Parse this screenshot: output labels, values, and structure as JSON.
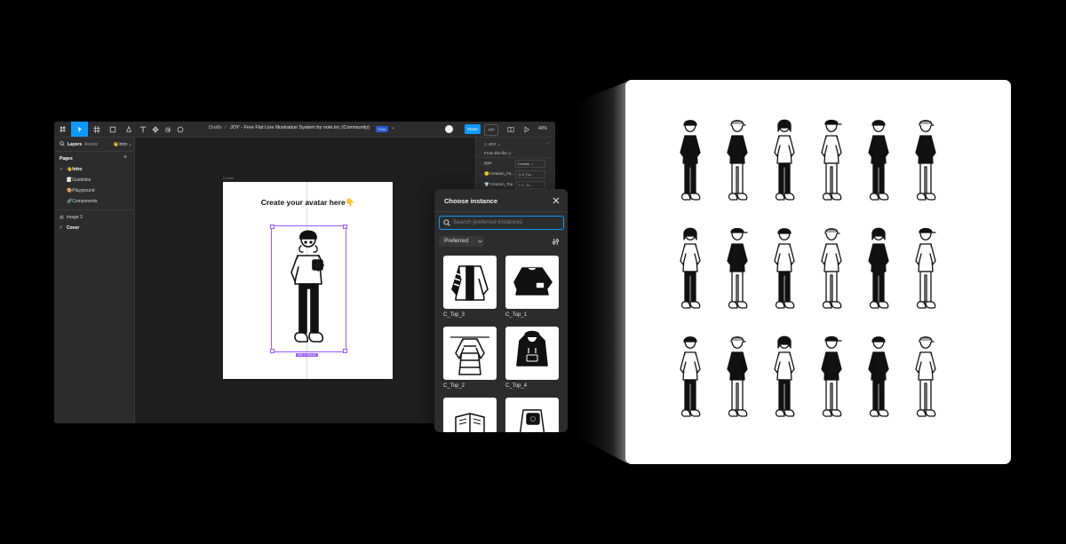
{
  "figma": {
    "breadcrumb_root": "Drafts",
    "breadcrumb_sep": "/",
    "file_title": "JOY - Free Flat Line Illustration System by note.inc (Community)",
    "plan_badge": "Free",
    "share_label": "Share",
    "dev_label": "</>",
    "zoom": "40%",
    "left_panel": {
      "tab_layers": "Layers",
      "tab_assets": "Assets",
      "current_page": "Intro",
      "pages_heading": "Pages",
      "add_symbol": "+",
      "pages": [
        "Intro",
        "Guideline",
        "Playground",
        "Components"
      ],
      "layers": [
        "image 3",
        "Cover"
      ]
    },
    "canvas": {
      "frame_label": "Create",
      "artboard_title": "Create your avatar here👇",
      "size_tag": "404 × 764.31"
    },
    "right_panel": {
      "component_name": "JOY",
      "from_this_file": "From this file",
      "type_label": "type",
      "type_value": "Creator",
      "prop_1_label": "Creation_Fa...",
      "prop_1_value": "C_Fa...",
      "prop_2_label": "Creation_Top",
      "prop_2_value": "C_To..."
    }
  },
  "popup": {
    "title": "Choose instance",
    "search_placeholder": "Search preferred instances",
    "filter_label": "Preferred",
    "items": [
      {
        "label": "C_Top_3",
        "icon": "striped-jacket-icon"
      },
      {
        "label": "C_Top_1",
        "icon": "black-sweater-icon"
      },
      {
        "label": "C_Top_2",
        "icon": "striped-dress-icon"
      },
      {
        "label": "C_Top_4",
        "icon": "black-hoodie-icon"
      },
      {
        "label": "",
        "icon": "reading-book-icon"
      },
      {
        "label": "",
        "icon": "camera-top-icon"
      }
    ]
  },
  "preview": {
    "rows": 3,
    "columns": 6,
    "description_icons": "character-illustration-icon"
  }
}
